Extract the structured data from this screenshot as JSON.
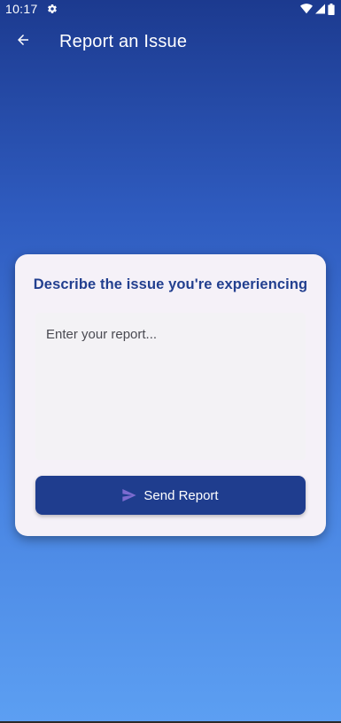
{
  "status_bar": {
    "time": "10:17",
    "icons": [
      "settings-icon",
      "wifi-icon",
      "signal-icon",
      "battery-icon"
    ]
  },
  "app_bar": {
    "back_icon": "arrow-left-icon",
    "title": "Report an Issue"
  },
  "card": {
    "heading": "Describe the issue you're experiencing",
    "report_input": {
      "value": "",
      "placeholder": "Enter your report..."
    },
    "send_button": {
      "label": "Send Report",
      "icon": "send-icon"
    }
  },
  "colors": {
    "gradient_top": "#1c3a8f",
    "gradient_bottom": "#5c9ff2",
    "card_background": "#f5f1f8",
    "heading": "#223f8f",
    "button": "#1f3d8e",
    "send_icon": "#7c6bd0"
  }
}
